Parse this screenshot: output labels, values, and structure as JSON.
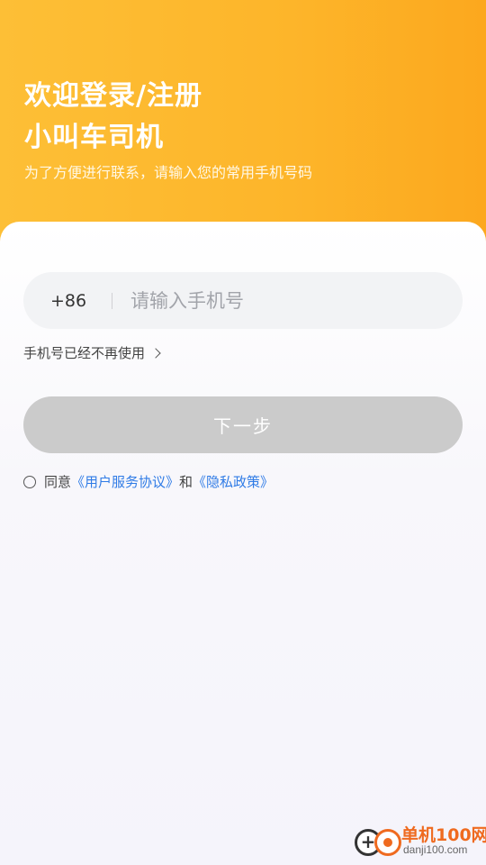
{
  "header": {
    "title_line1": "欢迎登录/注册",
    "title_line2": "小叫车司机",
    "subtitle": "为了方便进行联系，请输入您的常用手机号码"
  },
  "phone": {
    "country_code": "+86",
    "placeholder": "请输入手机号",
    "value": ""
  },
  "no_longer_link": "手机号已经不再使用",
  "next_button": "下一步",
  "agreement": {
    "checked": false,
    "prefix": "同意",
    "user_agreement": "《用户服务协议》",
    "conjunction": "和",
    "privacy_policy": "《隐私政策》"
  },
  "watermark": {
    "name": "单机100网",
    "domain": "danji100.com"
  },
  "colors": {
    "header_start": "#fdbf36",
    "header_end": "#fca81e",
    "button_disabled": "#cbcbcb",
    "link": "#2f7be6"
  }
}
